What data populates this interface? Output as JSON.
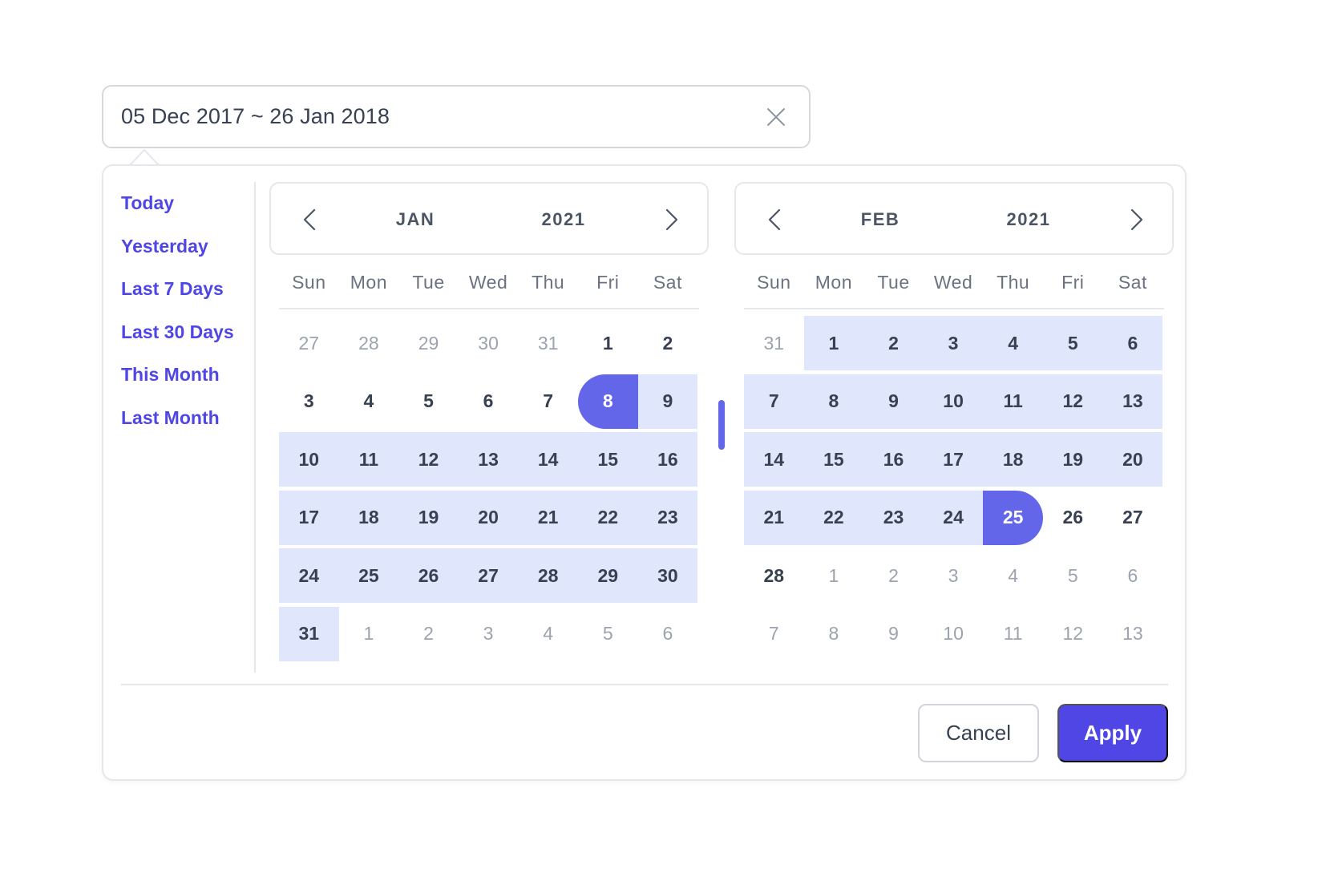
{
  "input": {
    "value": "05 Dec 2017 ~ 26 Jan 2018",
    "clear_icon": "close-icon"
  },
  "presets": [
    {
      "label": "Today"
    },
    {
      "label": "Yesterday"
    },
    {
      "label": "Last 7 Days"
    },
    {
      "label": "Last 30 Days"
    },
    {
      "label": "This Month"
    },
    {
      "label": "Last Month"
    }
  ],
  "weekdays": [
    "Sun",
    "Mon",
    "Tue",
    "Wed",
    "Thu",
    "Fri",
    "Sat"
  ],
  "calendars": [
    {
      "month": "JAN",
      "year": "2021",
      "prev_icon": "chevron-left-icon",
      "next_icon": "chevron-right-icon",
      "weeks": [
        [
          {
            "d": "27",
            "s": "muted"
          },
          {
            "d": "28",
            "s": "muted"
          },
          {
            "d": "29",
            "s": "muted"
          },
          {
            "d": "30",
            "s": "muted"
          },
          {
            "d": "31",
            "s": "muted"
          },
          {
            "d": "1",
            "s": ""
          },
          {
            "d": "2",
            "s": ""
          }
        ],
        [
          {
            "d": "3",
            "s": ""
          },
          {
            "d": "4",
            "s": ""
          },
          {
            "d": "5",
            "s": ""
          },
          {
            "d": "6",
            "s": ""
          },
          {
            "d": "7",
            "s": ""
          },
          {
            "d": "8",
            "s": "start"
          },
          {
            "d": "9",
            "s": "inrange"
          }
        ],
        [
          {
            "d": "10",
            "s": "inrange"
          },
          {
            "d": "11",
            "s": "inrange"
          },
          {
            "d": "12",
            "s": "inrange"
          },
          {
            "d": "13",
            "s": "inrange"
          },
          {
            "d": "14",
            "s": "inrange"
          },
          {
            "d": "15",
            "s": "inrange"
          },
          {
            "d": "16",
            "s": "inrange"
          }
        ],
        [
          {
            "d": "17",
            "s": "inrange"
          },
          {
            "d": "18",
            "s": "inrange"
          },
          {
            "d": "19",
            "s": "inrange"
          },
          {
            "d": "20",
            "s": "inrange"
          },
          {
            "d": "21",
            "s": "inrange"
          },
          {
            "d": "22",
            "s": "inrange"
          },
          {
            "d": "23",
            "s": "inrange"
          }
        ],
        [
          {
            "d": "24",
            "s": "inrange"
          },
          {
            "d": "25",
            "s": "inrange"
          },
          {
            "d": "26",
            "s": "inrange"
          },
          {
            "d": "27",
            "s": "inrange"
          },
          {
            "d": "28",
            "s": "inrange"
          },
          {
            "d": "29",
            "s": "inrange"
          },
          {
            "d": "30",
            "s": "inrange"
          }
        ],
        [
          {
            "d": "31",
            "s": "inrange"
          },
          {
            "d": "1",
            "s": "muted"
          },
          {
            "d": "2",
            "s": "muted"
          },
          {
            "d": "3",
            "s": "muted"
          },
          {
            "d": "4",
            "s": "muted"
          },
          {
            "d": "5",
            "s": "muted"
          },
          {
            "d": "6",
            "s": "muted"
          }
        ]
      ]
    },
    {
      "month": "FEB",
      "year": "2021",
      "prev_icon": "chevron-left-icon",
      "next_icon": "chevron-right-icon",
      "weeks": [
        [
          {
            "d": "31",
            "s": "muted"
          },
          {
            "d": "1",
            "s": "inrange"
          },
          {
            "d": "2",
            "s": "inrange"
          },
          {
            "d": "3",
            "s": "inrange"
          },
          {
            "d": "4",
            "s": "inrange"
          },
          {
            "d": "5",
            "s": "inrange"
          },
          {
            "d": "6",
            "s": "inrange"
          }
        ],
        [
          {
            "d": "7",
            "s": "inrange"
          },
          {
            "d": "8",
            "s": "inrange"
          },
          {
            "d": "9",
            "s": "inrange"
          },
          {
            "d": "10",
            "s": "inrange"
          },
          {
            "d": "11",
            "s": "inrange"
          },
          {
            "d": "12",
            "s": "inrange"
          },
          {
            "d": "13",
            "s": "inrange"
          }
        ],
        [
          {
            "d": "14",
            "s": "inrange"
          },
          {
            "d": "15",
            "s": "inrange"
          },
          {
            "d": "16",
            "s": "inrange"
          },
          {
            "d": "17",
            "s": "inrange"
          },
          {
            "d": "18",
            "s": "inrange"
          },
          {
            "d": "19",
            "s": "inrange"
          },
          {
            "d": "20",
            "s": "inrange"
          }
        ],
        [
          {
            "d": "21",
            "s": "inrange"
          },
          {
            "d": "22",
            "s": "inrange"
          },
          {
            "d": "23",
            "s": "inrange"
          },
          {
            "d": "24",
            "s": "inrange"
          },
          {
            "d": "25",
            "s": "end"
          },
          {
            "d": "26",
            "s": ""
          },
          {
            "d": "27",
            "s": ""
          }
        ],
        [
          {
            "d": "28",
            "s": ""
          },
          {
            "d": "1",
            "s": "muted"
          },
          {
            "d": "2",
            "s": "muted"
          },
          {
            "d": "3",
            "s": "muted"
          },
          {
            "d": "4",
            "s": "muted"
          },
          {
            "d": "5",
            "s": "muted"
          },
          {
            "d": "6",
            "s": "muted"
          }
        ],
        [
          {
            "d": "7",
            "s": "muted"
          },
          {
            "d": "8",
            "s": "muted"
          },
          {
            "d": "9",
            "s": "muted"
          },
          {
            "d": "10",
            "s": "muted"
          },
          {
            "d": "11",
            "s": "muted"
          },
          {
            "d": "12",
            "s": "muted"
          },
          {
            "d": "13",
            "s": "muted"
          }
        ]
      ]
    }
  ],
  "selection": {
    "start": "8 Jan 2021",
    "end": "25 Feb 2021"
  },
  "colors": {
    "accent": "#4f46e5",
    "selected": "#6366e8",
    "range": "#e0e7fc"
  },
  "footer": {
    "cancel_label": "Cancel",
    "apply_label": "Apply"
  }
}
